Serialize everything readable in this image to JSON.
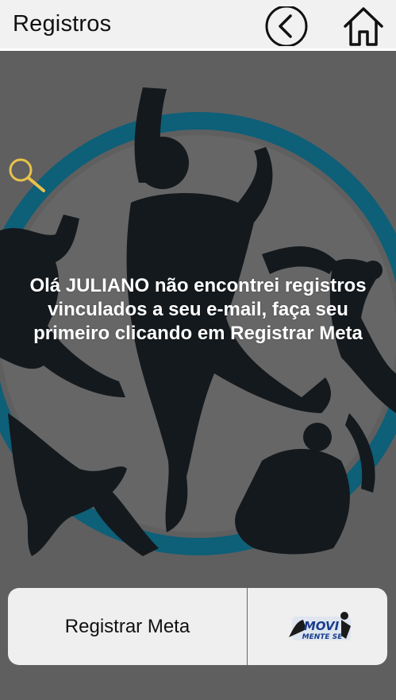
{
  "header": {
    "title": "Registros",
    "back_icon": "chevron-left-circle-icon",
    "home_icon": "home-icon"
  },
  "main": {
    "search_icon": "search-icon",
    "message": "Olá JULIANO não encontrei registros vinculados a seu e-mail, faça seu primeiro clicando em Registrar Meta",
    "background_image": "dancers-illustration"
  },
  "footer": {
    "register_label": "Registrar Meta",
    "logo": {
      "line1": "MOVI",
      "line2": "MENTE SE"
    }
  },
  "colors": {
    "header_bg": "#f1f1f1",
    "overlay": "#5f5f5f",
    "ring": "#0e5f78",
    "silhouette": "#14191d",
    "search_icon": "#e8c24a"
  }
}
